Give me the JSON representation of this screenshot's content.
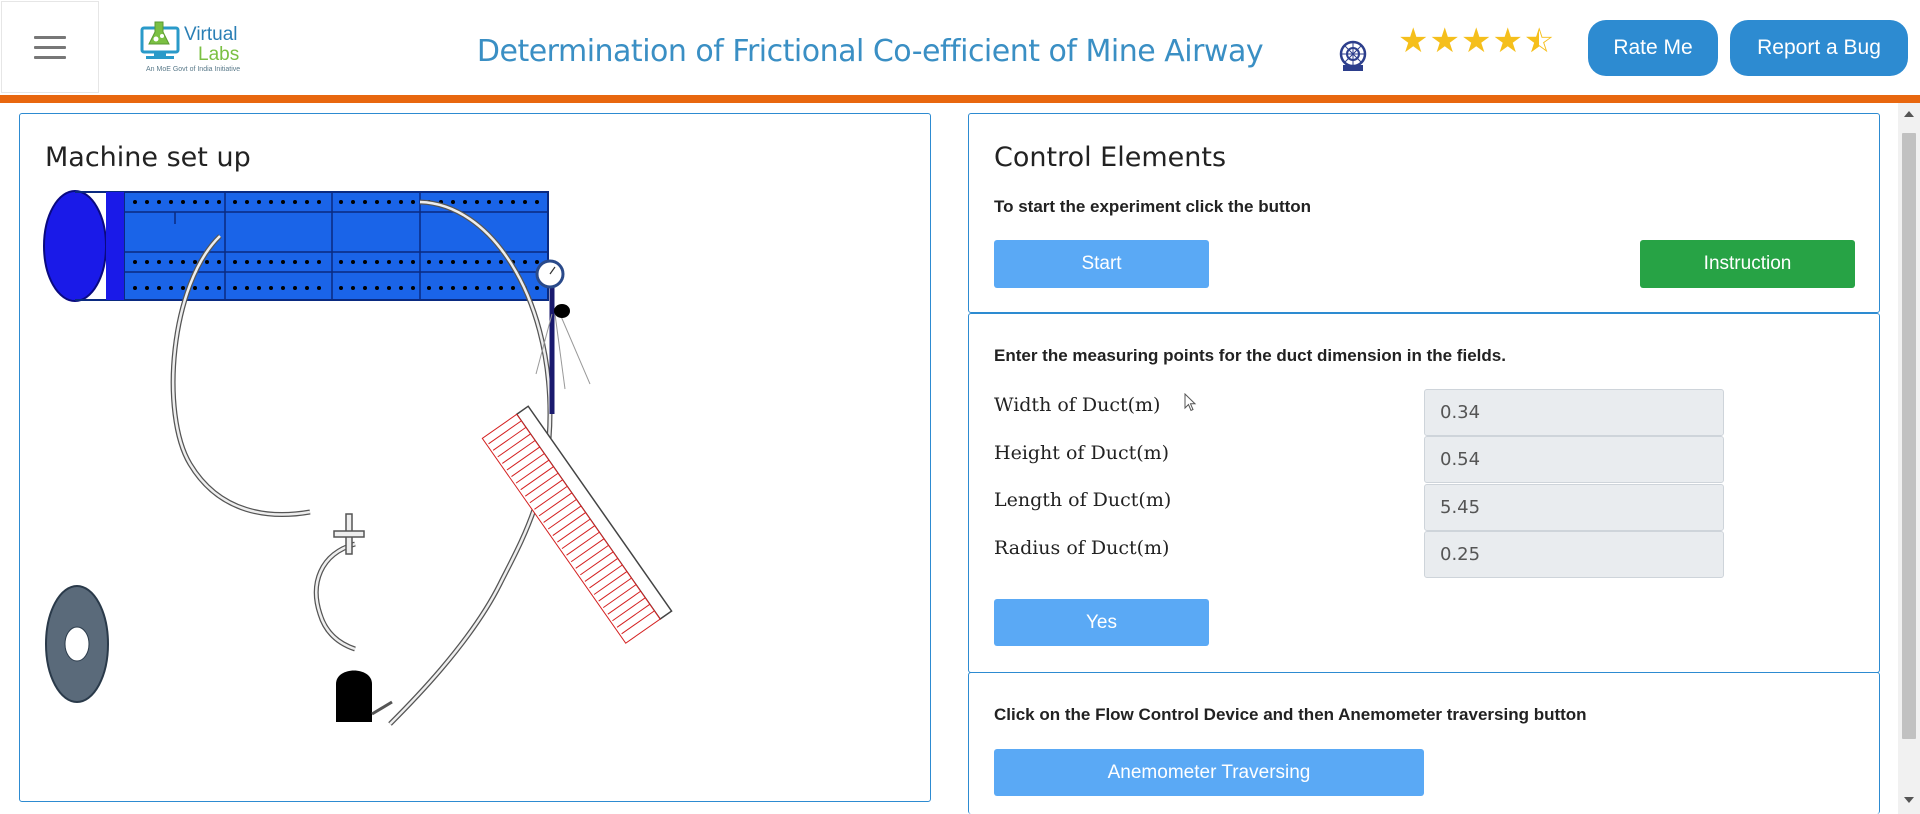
{
  "header": {
    "logo_text_top": "Virtual",
    "logo_text_bottom": "Labs",
    "logo_tagline": "An MoE Govt of India Initiative",
    "title": "Determination of Frictional Co-efficient of Mine Airway",
    "rating_stars": 4.5,
    "rate_label": "Rate Me",
    "bug_label": "Report a Bug"
  },
  "machine": {
    "title": "Machine set up"
  },
  "control": {
    "title": "Control Elements",
    "start_instruction": "To start the experiment click the button",
    "start_label": "Start",
    "instruction_label": "Instruction",
    "duct_instruction": "Enter the measuring points for the duct dimension in the fields.",
    "fields": [
      {
        "label": "Width of Duct(m)",
        "value": "0.34"
      },
      {
        "label": "Height of Duct(m)",
        "value": "0.54"
      },
      {
        "label": "Length of Duct(m)",
        "value": "5.45"
      },
      {
        "label": "Radius of Duct(m)",
        "value": "0.25"
      }
    ],
    "yes_label": "Yes",
    "flow_instruction": "Click on the Flow Control Device and then Anemometer traversing button",
    "anemometer_label": "Anemometer Traversing"
  },
  "colors": {
    "accent": "#2d8bd1",
    "orange_bar": "#e8670f",
    "title_blue": "#3a8fc4",
    "button_light_blue": "#5aa9f5",
    "button_green": "#27a345",
    "duct_blue": "#1a64e8",
    "manometer_red": "#d42020"
  },
  "icons": [
    "hamburger-icon",
    "virtual-labs-logo",
    "iit-emblem-icon",
    "star-icon",
    "mouse-cursor-icon"
  ]
}
